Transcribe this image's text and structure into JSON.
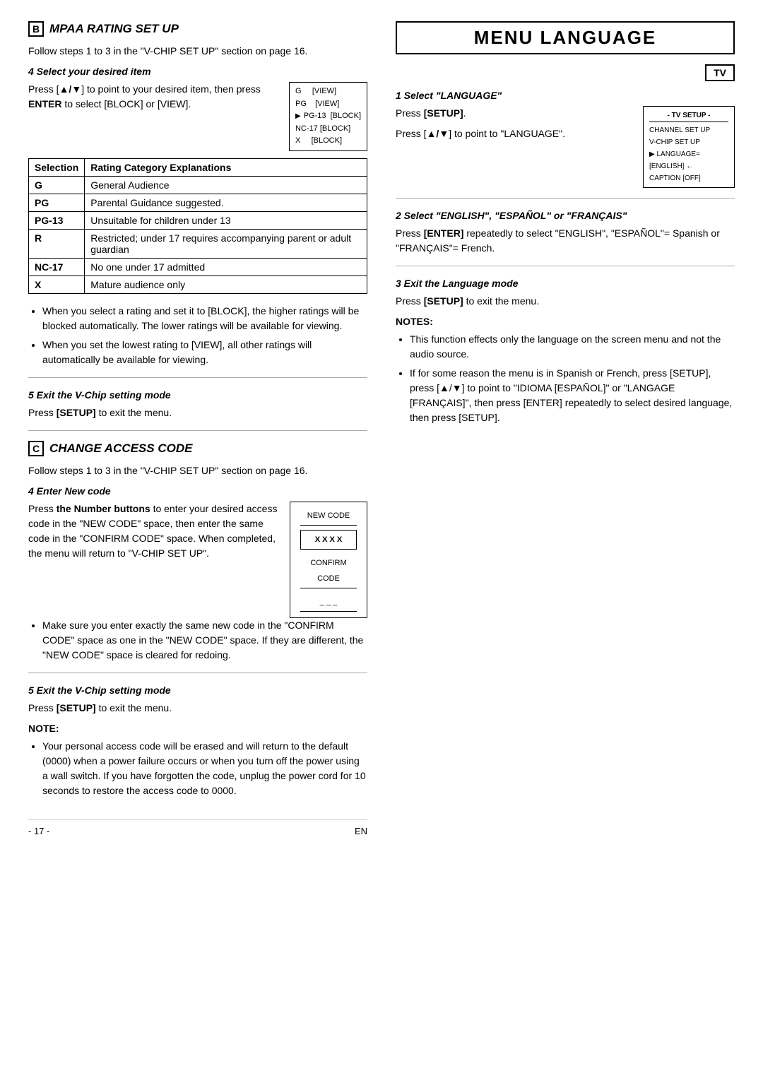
{
  "page": {
    "page_number": "- 17 -",
    "page_lang": "EN"
  },
  "section_b": {
    "letter": "B",
    "title": "MPAA RATING SET UP",
    "intro": "Follow steps 1 to 3 in the \"V-CHIP SET UP\" section on page 16.",
    "step4_label": "4  Select your desired item",
    "step4_text": "Press [▲/▼] to point to your desired item, then press ENTER to select [BLOCK] or [VIEW].",
    "table": {
      "col1_header": "Selection",
      "col2_header": "Rating Category Explanations",
      "rows": [
        {
          "sel": "G",
          "desc": "General Audience"
        },
        {
          "sel": "PG",
          "desc": "Parental Guidance suggested."
        },
        {
          "sel": "PG-13",
          "desc": "Unsuitable for children under 13"
        },
        {
          "sel": "R",
          "desc": "Restricted; under 17 requires accompanying parent or adult guardian"
        },
        {
          "sel": "NC-17",
          "desc": "No one under 17 admitted"
        },
        {
          "sel": "X",
          "desc": "Mature audience only"
        }
      ]
    },
    "bullets": [
      "When you select a rating and set it to [BLOCK], the higher ratings will be blocked automatically. The lower ratings will be available for viewing.",
      "When you set the lowest rating to [VIEW], all other ratings will automatically be available for viewing."
    ],
    "step5_label": "5  Exit the V-Chip setting mode",
    "step5_text": "Press [SETUP] to exit the menu."
  },
  "section_c": {
    "letter": "C",
    "title": "CHANGE ACCESS CODE",
    "intro": "Follow steps 1 to 3 in the \"V-CHIP SET UP\" section on page 16.",
    "step4_label": "4  Enter New code",
    "step4_text_1": "Press the Number buttons to enter your desired access code in the \"NEW CODE\" space, then enter the same code in the \"CONFIRM CODE\" space. When completed, the menu will return to \"V-CHIP SET UP\".",
    "code_box": {
      "new_code_label": "NEW CODE",
      "new_code_value": "X X X X",
      "confirm_label": "CONFIRM CODE",
      "confirm_value": "_ _ _"
    },
    "bullets": [
      "Make sure you enter exactly the same new code in the \"CONFIRM CODE\" space as one in the \"NEW CODE\" space. If they are different, the \"NEW CODE\" space is cleared for redoing."
    ],
    "step5_label": "5  Exit the V-Chip setting mode",
    "step5_text": "Press [SETUP] to exit the menu.",
    "note_label": "NOTE:",
    "note_text": "Your personal access code will be erased and will return to the default (0000) when a power failure occurs or when you turn off the power using a wall switch. If you have forgotten the code, unplug the power cord for 10 seconds to restore the access code to 0000."
  },
  "section_menu_language": {
    "title": "MENU LANGUAGE",
    "tv_badge": "TV",
    "step1_label": "1  Select \"LANGUAGE\"",
    "step1_text_1": "Press [SETUP].",
    "step1_text_2": "Press [▲/▼] to point to \"LANGUAGE\".",
    "tv_screen": {
      "title": "- TV SETUP -",
      "items": [
        "CHANNEL SET UP",
        "V-CHIP SET UP",
        "LANGUAGE=[ENGLISH] ←",
        "CAPTION [OFF]"
      ]
    },
    "step2_label": "2  Select \"ENGLISH\", \"ESPAÑOL\" or \"FRANÇAIS\"",
    "step2_text": "Press [ENTER] repeatedly to select \"ENGLISH\", \"ESPAÑOL\"= Spanish or \"FRANÇAIS\"= French.",
    "step3_label": "3  Exit the Language mode",
    "step3_text": "Press [SETUP] to exit the menu.",
    "notes_label": "NOTES:",
    "notes": [
      "This function effects only the language on the screen menu and not the audio source.",
      "If for some reason the menu is in Spanish or French, press [SETUP], press [▲/▼] to point to \"IDIOMA [ESPAÑOL]\" or \"LANGAGE [FRANÇAIS]\", then press [ENTER] repeatedly to select desired language, then press [SETUP]."
    ]
  },
  "mini_screen_b": {
    "items": [
      {
        "label": "G",
        "status": "[VIEW]"
      },
      {
        "label": "PG",
        "status": "[VIEW]"
      },
      {
        "label": "PG-13",
        "status": "[BLOCK]",
        "arrow": true
      },
      {
        "label": "NC-17",
        "status": "[BLOCK]"
      },
      {
        "label": "X",
        "status": "[BLOCK]"
      }
    ]
  }
}
